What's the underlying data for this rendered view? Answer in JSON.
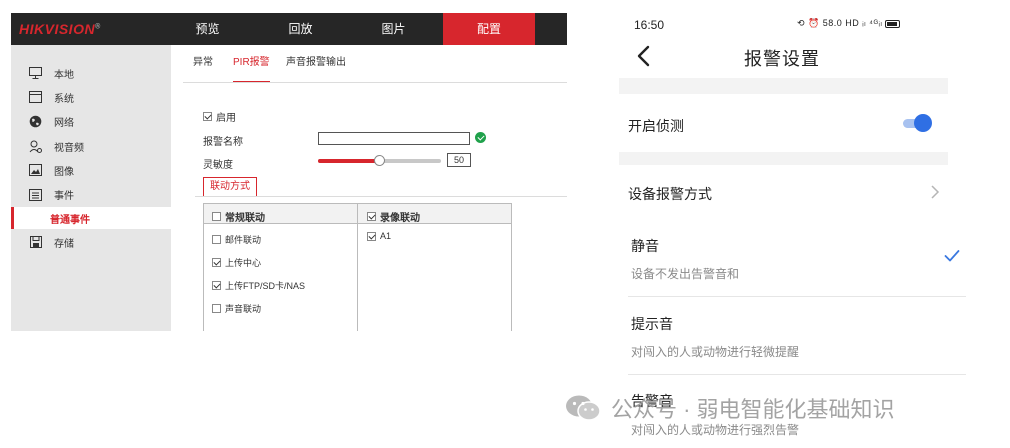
{
  "hikvision": {
    "logo": "HIKVISION",
    "logo_mark": "®",
    "nav_tabs": [
      "预览",
      "回放",
      "图片",
      "配置"
    ],
    "active_tab": "配置",
    "sidebar": [
      {
        "label": "本地",
        "icon": "monitor-icon"
      },
      {
        "label": "系统",
        "icon": "system-icon"
      },
      {
        "label": "网络",
        "icon": "globe-icon"
      },
      {
        "label": "视音频",
        "icon": "mic-icon"
      },
      {
        "label": "图像",
        "icon": "image-icon"
      },
      {
        "label": "事件",
        "icon": "calendar-icon"
      },
      {
        "label": "普通事件",
        "icon": ""
      },
      {
        "label": "存储",
        "icon": "save-icon"
      }
    ],
    "sub_tabs": [
      "异常",
      "PIR报警",
      "声音报警输出"
    ],
    "active_sub_tab": "PIR报警",
    "enable_label": "启用",
    "enable_checked": true,
    "alarm_name_label": "报警名称",
    "alarm_name_value": "",
    "sensitivity_label": "灵敏度",
    "sensitivity_value": "50",
    "sensitivity_level": 0.5,
    "linkage_button": "联动方式",
    "table": {
      "normal_header": "常规联动",
      "normal_header_checked": false,
      "record_header": "录像联动",
      "record_header_checked": true,
      "normal_items": [
        {
          "label": "邮件联动",
          "checked": false
        },
        {
          "label": "上传中心",
          "checked": true
        },
        {
          "label": "上传FTP/SD卡/NAS",
          "checked": true
        },
        {
          "label": "声音联动",
          "checked": false
        }
      ],
      "record_items": [
        {
          "label": "A1",
          "checked": true
        }
      ]
    }
  },
  "phone": {
    "time": "16:50",
    "status_icons": "⟲ ⏰ 58.0 HD ᵢₗ ⁴ᴳᵢₗ",
    "title": "报警设置",
    "detect_label": "开启侦测",
    "detect_on": true,
    "alarm_mode_label": "设备报警方式",
    "options": [
      {
        "title": "静音",
        "desc": "设备不发出告警音和",
        "selected": true
      },
      {
        "title": "提示音",
        "desc": "对闯入的人或动物进行轻微提醒",
        "selected": false
      },
      {
        "title": "告警音",
        "desc": "对闯入的人或动物进行强烈告警",
        "selected": false
      }
    ]
  },
  "watermark": {
    "text": "公众号 · 弱电智能化基础知识"
  },
  "colors": {
    "brand_red": "#d7262d",
    "toggle_blue": "#2f6fe4",
    "check_blue": "#3a78e0"
  }
}
